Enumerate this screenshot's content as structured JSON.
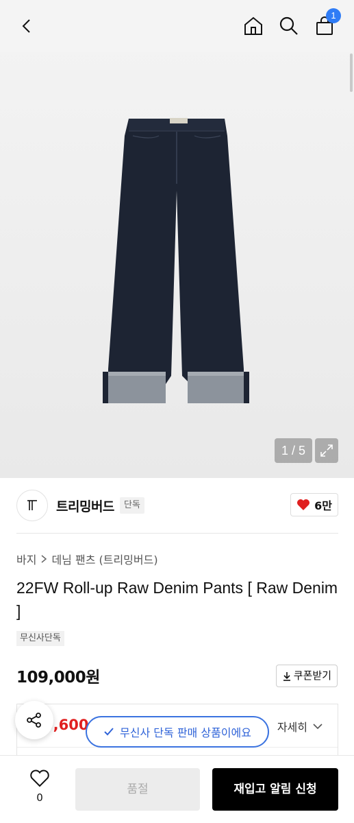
{
  "header": {
    "cart_count": "1",
    "icons": [
      "back-icon",
      "home-icon",
      "search-icon",
      "cart-icon"
    ]
  },
  "gallery": {
    "counter": "1 / 5"
  },
  "brand": {
    "name": "트리밍버드",
    "tag": "단독",
    "logo_text": "T",
    "likes": "6만"
  },
  "breadcrumb": {
    "items": [
      "바지",
      "데님 팬츠 (트리밍버드)"
    ]
  },
  "product": {
    "title": "22FW Roll-up Raw Denim Pants [ Raw Denim ]",
    "tag": "무신사단독",
    "price": "109,000원",
    "coupon_label": "쿠폰받기",
    "benefit_price": "3,600",
    "detail_label": "자세히"
  },
  "toast": {
    "text": "무신사 단독 판매 상품이에요"
  },
  "bottom": {
    "wish_count": "0",
    "soldout_label": "품절",
    "restock_label": "재입고 알림 신청"
  },
  "colors": {
    "accent_blue": "#2f7cf6",
    "heart_red": "#e02020",
    "denim": "#1d2433"
  }
}
